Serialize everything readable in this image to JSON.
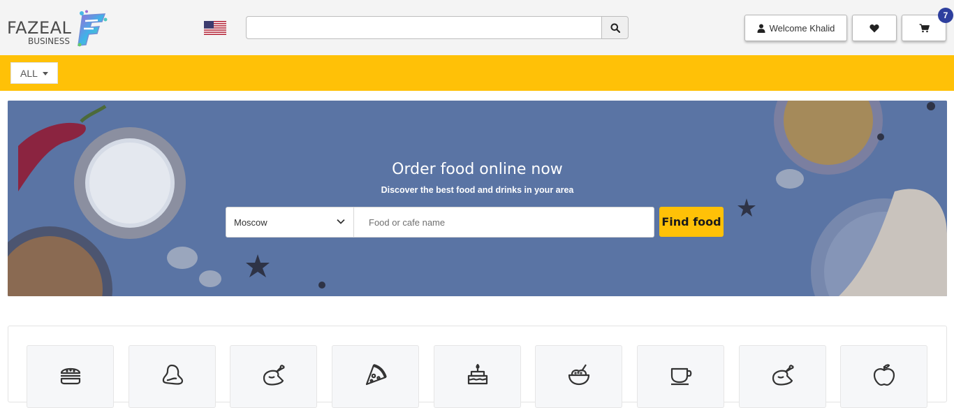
{
  "header": {
    "logo": {
      "brand": "FAZEAL",
      "sub": "BUSINESS",
      "mark": "F"
    },
    "language_flag": "us-flag-icon",
    "search": {
      "value": "",
      "placeholder": ""
    },
    "welcome_label": "Welcome Khalid",
    "cart_count": "7"
  },
  "category_bar": {
    "all_label": "ALL"
  },
  "hero": {
    "title": "Order food online now",
    "subtitle": "Discover the best food and drinks in your area",
    "city_selected": "Moscow",
    "food_placeholder": "Food or cafe name",
    "find_label": "Find food"
  },
  "categories": [
    {
      "icon": "burger-icon"
    },
    {
      "icon": "meat-icon"
    },
    {
      "icon": "chicken-icon"
    },
    {
      "icon": "pizza-icon"
    },
    {
      "icon": "cake-icon"
    },
    {
      "icon": "rice-bowl-icon"
    },
    {
      "icon": "coffee-cup-icon"
    },
    {
      "icon": "chicken-icon"
    },
    {
      "icon": "apple-icon"
    }
  ],
  "colors": {
    "accent_yellow": "#ffc107",
    "badge_blue": "#2e3f9e",
    "hero_overlay": "#56709f"
  }
}
